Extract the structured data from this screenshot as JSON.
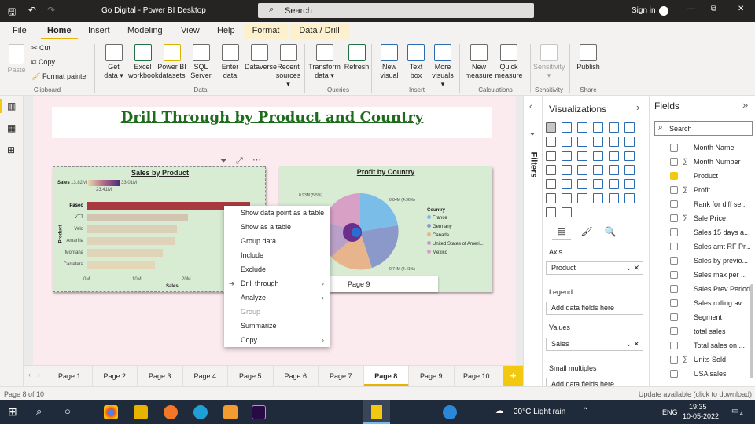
{
  "titlebar": {
    "title": "Go Digital - Power BI Desktop",
    "search": "Search",
    "signin": "Sign in",
    "minimize": "—",
    "restore": "⧉",
    "close": "✕"
  },
  "tabs": [
    "File",
    "Home",
    "Insert",
    "Modeling",
    "View",
    "Help",
    "Format",
    "Data / Drill"
  ],
  "ribbon": {
    "clipboard": {
      "paste": "Paste",
      "cut": "Cut",
      "copy": "Copy",
      "format_painter": "Format painter",
      "group": "Clipboard"
    },
    "data": {
      "items": [
        [
          "Get",
          "data ▾"
        ],
        [
          "Excel",
          "workbook"
        ],
        [
          "Power BI",
          "datasets"
        ],
        [
          "SQL",
          "Server"
        ],
        [
          "Enter",
          "data"
        ],
        [
          "Dataverse",
          ""
        ],
        [
          "Recent",
          "sources ▾"
        ]
      ],
      "group": "Data"
    },
    "queries": {
      "items": [
        [
          "Transform",
          "data ▾"
        ],
        [
          "Refresh",
          ""
        ]
      ],
      "group": "Queries"
    },
    "insert": {
      "items": [
        [
          "New",
          "visual"
        ],
        [
          "Text",
          "box"
        ],
        [
          "More",
          "visuals ▾"
        ]
      ],
      "group": "Insert"
    },
    "calculations": {
      "items": [
        [
          "New",
          "measure"
        ],
        [
          "Quick",
          "measure"
        ]
      ],
      "group": "Calculations"
    },
    "sensitivity": {
      "items": [
        [
          "Sensitivity",
          "▾"
        ]
      ],
      "group": "Sensitivity"
    },
    "share": {
      "items": [
        [
          "Publish",
          ""
        ]
      ],
      "group": "Share"
    }
  },
  "report": {
    "title": "Drill Through by Product and Country",
    "sales_visual": {
      "title": "Sales by Product",
      "legend_label": "Sales",
      "legend_min": "13.82M",
      "legend_max": "33.01M",
      "legend_mid": "23.41M",
      "y_label": "Product",
      "x_label": "Sales",
      "x_ticks": [
        "0M",
        "10M",
        "20M"
      ]
    },
    "profit_visual": {
      "title": "Profit by Country",
      "legend_title": "Country",
      "labels": [
        "0.93M (5.5%)",
        "0.84M (4.96%)",
        "0.74M (4.41%)"
      ]
    },
    "tooltip": "Page 9"
  },
  "chart_data": [
    {
      "type": "bar",
      "title": "Sales by Product",
      "xlabel": "Sales",
      "ylabel": "Product",
      "categories": [
        "Paseo",
        "VTT",
        "Velo",
        "Amarilla",
        "Montana",
        "Carretera"
      ],
      "values": [
        33.01,
        20.51,
        18.25,
        17.75,
        15.39,
        13.82
      ],
      "xlim": [
        0,
        33.01
      ],
      "unit": "M"
    },
    {
      "type": "pie",
      "title": "Profit by Country",
      "categories": [
        "France",
        "Germany",
        "Canada",
        "United States of Ameri...",
        "Mexico"
      ],
      "colors": [
        "#79bde8",
        "#8a99c9",
        "#e8b48c",
        "#b8a0c8",
        "#d9a0c6"
      ]
    }
  ],
  "context_menu": [
    {
      "label": "Show data point as a table",
      "sub": false,
      "disabled": false
    },
    {
      "label": "Show as a table",
      "sub": false,
      "disabled": false
    },
    {
      "label": "Group data",
      "sub": false,
      "disabled": false
    },
    {
      "label": "Include",
      "sub": false,
      "disabled": false
    },
    {
      "label": "Exclude",
      "sub": false,
      "disabled": false
    },
    {
      "label": "Drill through",
      "sub": true,
      "disabled": false
    },
    {
      "label": "Analyze",
      "sub": true,
      "disabled": false
    },
    {
      "label": "Group",
      "sub": false,
      "disabled": true
    },
    {
      "label": "Summarize",
      "sub": false,
      "disabled": false
    },
    {
      "label": "Copy",
      "sub": true,
      "disabled": false
    }
  ],
  "pages": [
    "Page 1",
    "Page 2",
    "Page 3",
    "Page 4",
    "Page 5",
    "Page 6",
    "Page 7",
    "Page 8",
    "Page 9",
    "Page 10"
  ],
  "selected_page": "Page 8",
  "add_page": "+",
  "status": {
    "left": "Page 8 of 10",
    "right": "Update available (click to download)"
  },
  "filters_label": "Filters",
  "visualizations": {
    "title": "Visualizations",
    "axis_label": "Axis",
    "axis_value": "Product",
    "legend_label": "Legend",
    "legend_placeholder": "Add data fields here",
    "values_label": "Values",
    "values_value": "Sales",
    "small_multiples_label": "Small multiples",
    "small_multiples_placeholder": "Add data fields here"
  },
  "fields": {
    "title": "Fields",
    "search_placeholder": "Search",
    "items": [
      {
        "label": "Month Name",
        "checked": false,
        "sigma": false
      },
      {
        "label": "Month Number",
        "checked": false,
        "sigma": true
      },
      {
        "label": "Product",
        "checked": true,
        "sigma": false
      },
      {
        "label": "Profit",
        "checked": false,
        "sigma": true
      },
      {
        "label": "Rank for diff se...",
        "checked": false,
        "sigma": false
      },
      {
        "label": "Sale Price",
        "checked": false,
        "sigma": true
      },
      {
        "label": "Sales 15 days a...",
        "checked": false,
        "sigma": false
      },
      {
        "label": "Sales amt RF Pr...",
        "checked": false,
        "sigma": false
      },
      {
        "label": "Sales by previo...",
        "checked": false,
        "sigma": false
      },
      {
        "label": "Sales max per ...",
        "checked": false,
        "sigma": false
      },
      {
        "label": "Sales Prev Period",
        "checked": false,
        "sigma": false
      },
      {
        "label": "Sales rolling av...",
        "checked": false,
        "sigma": false
      },
      {
        "label": "Segment",
        "checked": false,
        "sigma": false
      },
      {
        "label": "total sales",
        "checked": false,
        "sigma": false
      },
      {
        "label": "Total sales on ...",
        "checked": false,
        "sigma": false
      },
      {
        "label": "Units Sold",
        "checked": false,
        "sigma": true
      },
      {
        "label": "USA sales",
        "checked": false,
        "sigma": false
      }
    ]
  },
  "taskbar": {
    "weather": "30°C  Light rain",
    "lang": "ENG",
    "time": "19:35",
    "date": "10-05-2022",
    "notif": "4"
  }
}
